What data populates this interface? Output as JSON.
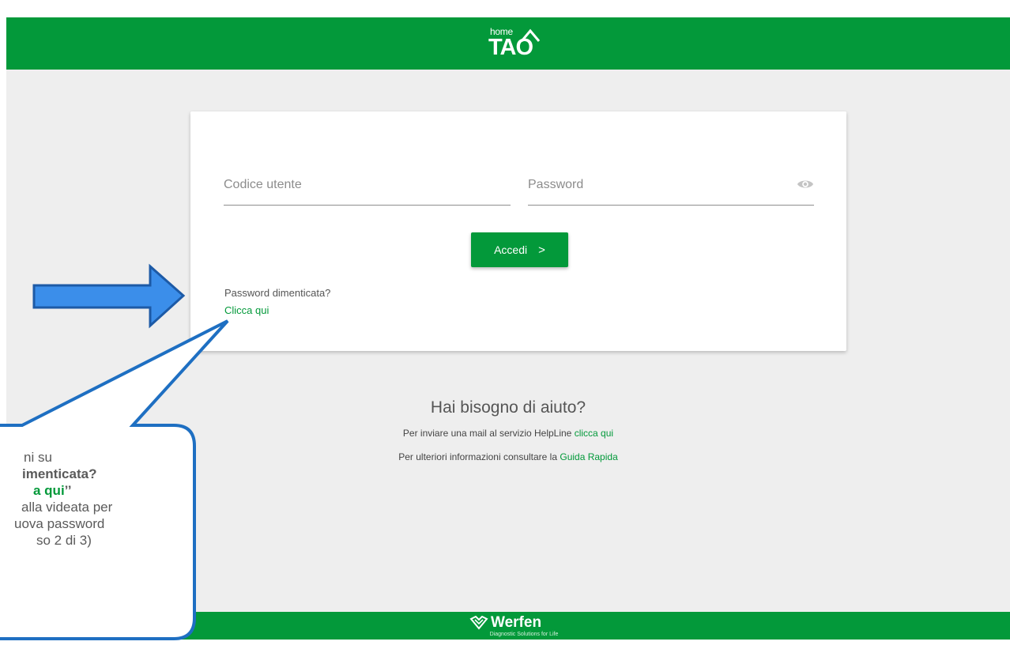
{
  "header": {
    "logo_small": "home",
    "logo_main": "TAO"
  },
  "login": {
    "username_placeholder": "Codice utente",
    "password_placeholder": "Password",
    "submit_label": "Accedi",
    "submit_icon": "chevron-right",
    "forgot_text": "Password dimenticata?",
    "forgot_link": "Clicca qui"
  },
  "help": {
    "title": "Hai bisogno di aiuto?",
    "line1_text": "Per inviare una mail al servizio HelpLine",
    "line1_link": "clicca qui",
    "line2_text": "Per ulteriori informazioni consultare la",
    "line2_link": "Guida Rapida"
  },
  "footer": {
    "brand": "Werfen",
    "tagline": "Diagnostic Solutions for Life"
  },
  "callout": {
    "line1": "ni su",
    "line2": "imenticata?",
    "line3_green": "a qui",
    "line3_quote": "’’",
    "line4": "alla videata per",
    "line5": "uova password",
    "line6": "so 2 di 3)"
  },
  "colors": {
    "brand_green": "#03993a",
    "background": "#eeeeee",
    "arrow_fill": "#3b8eea",
    "arrow_stroke": "#1d5aa6",
    "callout_stroke": "#1e6fc2"
  }
}
